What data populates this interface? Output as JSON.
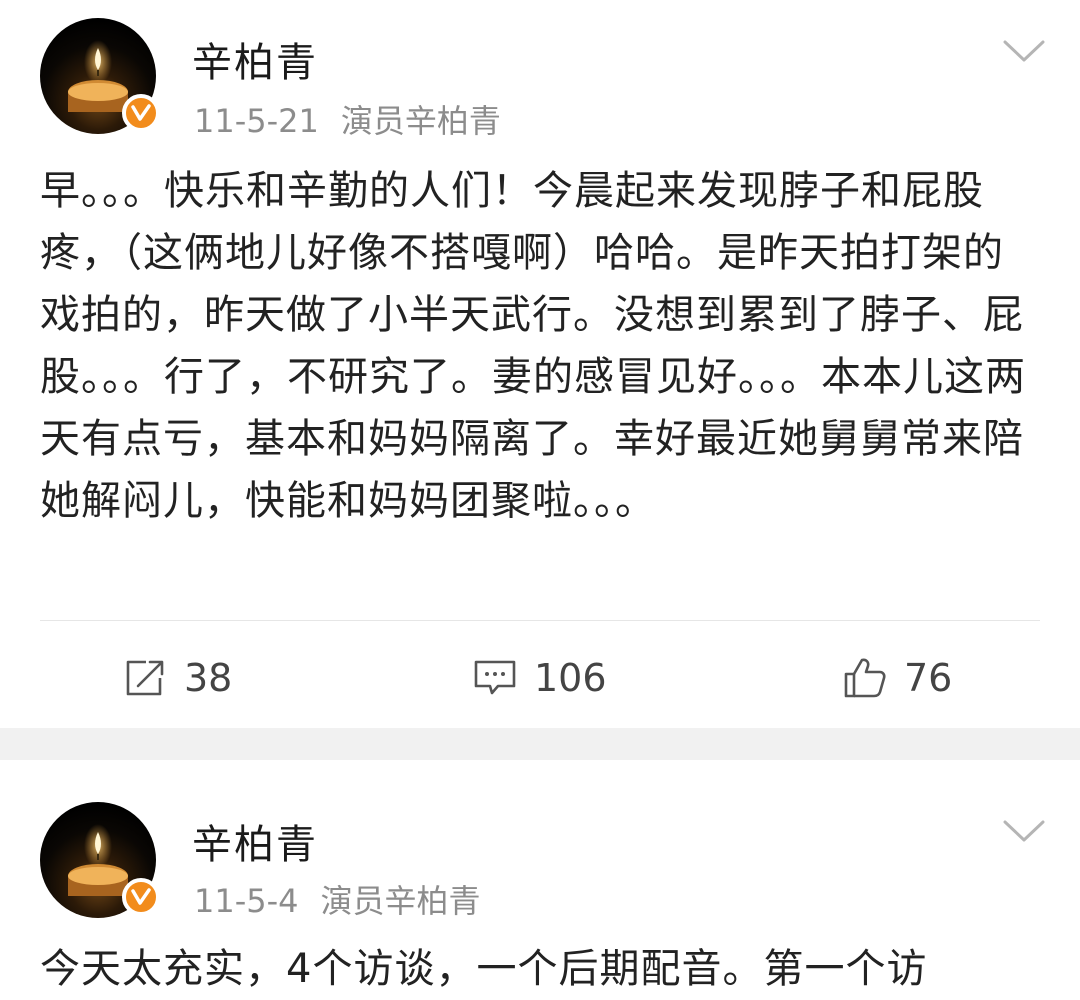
{
  "posts": [
    {
      "author": "辛柏青",
      "date": "11-5-21",
      "source": "演员辛柏青",
      "avatar_icon": "candle-avatar",
      "badge_icon": "verified-v-badge",
      "content": "早。。。快乐和辛勤的人们！今晨起来发现脖子和屁股疼，（这俩地儿好像不搭嘎啊）哈哈。是昨天拍打架的戏拍的，昨天做了小半天武行。没想到累到了脖子、屁股。。。行了，不研究了。妻的感冒见好。。。本本儿这两天有点亏，基本和妈妈隔离了。幸好最近她舅舅常来陪她解闷儿，快能和妈妈团聚啦。。。",
      "reposts": "38",
      "comments": "106",
      "likes": "76"
    },
    {
      "author": "辛柏青",
      "date": "11-5-4",
      "source": "演员辛柏青",
      "avatar_icon": "candle-avatar",
      "badge_icon": "verified-v-badge",
      "content": "今天太充实，4个访谈，一个后期配音。第一个访"
    }
  ],
  "colors": {
    "badge": "#f28c1c",
    "meta_text": "#8c8c8c",
    "separator": "#f1f1f1"
  }
}
